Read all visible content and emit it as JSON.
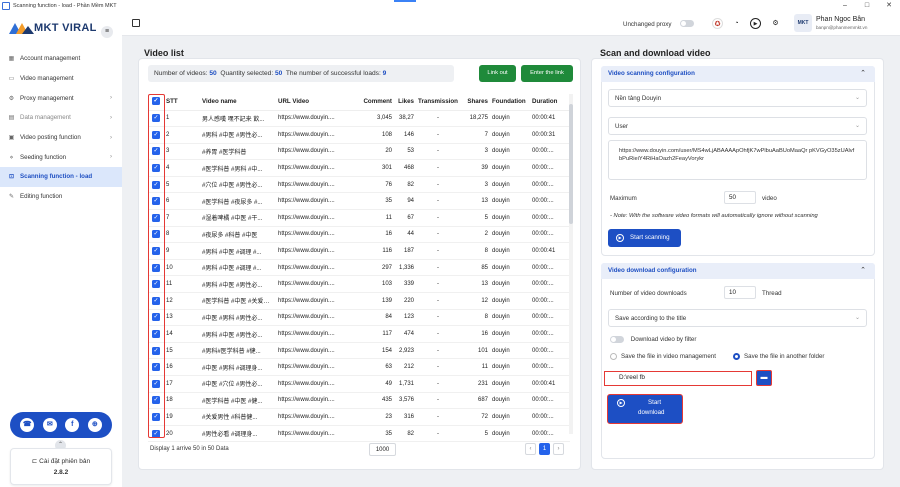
{
  "window": {
    "title": "Scanning function - load - Phần Mềm MKT",
    "min": "–",
    "max": "□",
    "close": "✕"
  },
  "sidebar": {
    "logo": "MKT VIRAL",
    "items": [
      {
        "label": "Account management",
        "icon": "grid-icon",
        "chev": "",
        "state": ""
      },
      {
        "label": "Video management",
        "icon": "video-icon",
        "chev": "",
        "state": ""
      },
      {
        "label": "Proxy management",
        "icon": "gear-icon",
        "chev": "›",
        "state": ""
      },
      {
        "label": "Data management",
        "icon": "database-icon",
        "chev": "›",
        "state": "muted"
      },
      {
        "label": "Video posting function",
        "icon": "monitor-icon",
        "chev": "›",
        "state": ""
      },
      {
        "label": "Seeding function",
        "icon": "share-icon",
        "chev": "›",
        "state": ""
      },
      {
        "label": "Scanning function - load",
        "icon": "scan-icon",
        "chev": "",
        "state": "active"
      },
      {
        "label": "Editing function",
        "icon": "edit-icon",
        "chev": "",
        "state": ""
      }
    ],
    "social": [
      "☎",
      "✉",
      "f",
      "⊕"
    ],
    "collapse": "⌃",
    "version": {
      "label": "Cài đặt phiên bản",
      "value": "2.8.2"
    }
  },
  "topbar": {
    "proxy_label": "Unchanged proxy",
    "user_name": "Phan Ngoc Bân",
    "user_email": "banpn@phanmemmkt.vn",
    "avatar_text": "MKT"
  },
  "video_list": {
    "title": "Video list",
    "stats": {
      "count_label": "Number of videos:",
      "count": "50",
      "selected_label": "Quantity selected:",
      "selected": "50",
      "success_label": "The number of successful loads:",
      "success": "9"
    },
    "link_out": "Link out",
    "enter_link": "Enter the link",
    "columns": [
      "STT",
      "Video name",
      "URL Video",
      "Comment",
      "Likes",
      "Transmission",
      "Shares",
      "Foundation",
      "Duration"
    ],
    "rows": [
      [
        "1",
        "男人感嘆 嘿不記来 飲...",
        "https://www.douyin....",
        "3,045",
        "38,27",
        "-",
        "18,275",
        "douyin",
        "00:00:41"
      ],
      [
        "2",
        "#男科 #中医 #男性必...",
        "https://www.douyin....",
        "108",
        "146",
        "-",
        "7",
        "douyin",
        "00:00:31"
      ],
      [
        "3",
        "#养胃 #医学科普",
        "https://www.douyin....",
        "20",
        "53",
        "-",
        "3",
        "douyin",
        "00:00:..."
      ],
      [
        "4",
        "#医学科普 #男科 #中...",
        "https://www.douyin....",
        "301",
        "468",
        "-",
        "39",
        "douyin",
        "00:00:..."
      ],
      [
        "5",
        "#穴位 #中医 #男性必...",
        "https://www.douyin....",
        "76",
        "82",
        "-",
        "3",
        "douyin",
        "00:00:..."
      ],
      [
        "6",
        "#医学科普 #夜尿多 #...",
        "https://www.douyin....",
        "35",
        "94",
        "-",
        "13",
        "douyin",
        "00:00:..."
      ],
      [
        "7",
        "#湿着啤橘 #中医 #干...",
        "https://www.douyin....",
        "11",
        "67",
        "-",
        "5",
        "douyin",
        "00:00:..."
      ],
      [
        "8",
        "#夜尿多 #科普 #中医",
        "https://www.douyin....",
        "16",
        "44",
        "-",
        "2",
        "douyin",
        "00:00:..."
      ],
      [
        "9",
        "#男科 #中医 #调理 #...",
        "https://www.douyin....",
        "116",
        "187",
        "-",
        "8",
        "douyin",
        "00:00:41"
      ],
      [
        "10",
        "#男科 #中医 #调理 #...",
        "https://www.douyin....",
        "297",
        "1,336",
        "-",
        "85",
        "douyin",
        "00:00:..."
      ],
      [
        "11",
        "#男科 #中医 #男性必...",
        "https://www.douyin....",
        "103",
        "339",
        "-",
        "13",
        "douyin",
        "00:00:..."
      ],
      [
        "12",
        "#医学科普 #中医 #关爱男...",
        "https://www.douyin....",
        "139",
        "220",
        "-",
        "12",
        "douyin",
        "00:00:..."
      ],
      [
        "13",
        "#中医 #男科 #男性必...",
        "https://www.douyin....",
        "84",
        "123",
        "-",
        "8",
        "douyin",
        "00:00:..."
      ],
      [
        "14",
        "#男科 #中医 #男性必...",
        "https://www.douyin....",
        "117",
        "474",
        "-",
        "16",
        "douyin",
        "00:00:..."
      ],
      [
        "15",
        "#男科#医学科普 #健...",
        "https://www.douyin....",
        "154",
        "2,923",
        "-",
        "101",
        "douyin",
        "00:00:..."
      ],
      [
        "16",
        "#中医 #男科 #调理身...",
        "https://www.douyin....",
        "63",
        "212",
        "-",
        "11",
        "douyin",
        "00:00:..."
      ],
      [
        "17",
        "#中医 #穴位 #男性必...",
        "https://www.douyin....",
        "49",
        "1,731",
        "-",
        "231",
        "douyin",
        "00:00:41"
      ],
      [
        "18",
        "#医学科普 #中医 #健...",
        "https://www.douyin....",
        "435",
        "3,576",
        "-",
        "687",
        "douyin",
        "00:00:..."
      ],
      [
        "19",
        "#关爱男性 #科普健...",
        "https://www.douyin....",
        "23",
        "316",
        "-",
        "72",
        "douyin",
        "00:00:..."
      ],
      [
        "20",
        "#男性必看 #调理身...",
        "https://www.douyin....",
        "35",
        "82",
        "-",
        "5",
        "douyin",
        "00:00:..."
      ]
    ],
    "footer": "Display 1 arrive 50 in 50 Data",
    "page_size": "1000",
    "page": "1",
    "prev": "‹",
    "next": "›"
  },
  "scan": {
    "title": "Scan and download video",
    "config_title": "Video scanning configuration",
    "platform": "Nền tảng Douyin",
    "mode": "User",
    "url": "https://www.douyin.com/user/MS4wLjABAAAApOhfjK7wPlbuAaBUoMaaQr pKVGyO35zUAlvfbPuRieiY4RiHaOazh2FeayVorykr",
    "max_label": "Maximum",
    "max_value": "50",
    "max_unit": "video",
    "note": "- Note: With the software video formats will automatically ignore without scanning",
    "start_scan": "Start scanning"
  },
  "download": {
    "config_title": "Video download configuration",
    "threads_label": "Number of video downloads",
    "threads_value": "10",
    "threads_unit": "Thread",
    "save_mode": "Save according to the title",
    "filter_label": "Download video by filter",
    "opt1": "Save the file in video management",
    "opt2": "Save the file in another folder",
    "path": "D:\\reel fb",
    "start_line1": "Start",
    "start_line2": "download"
  }
}
